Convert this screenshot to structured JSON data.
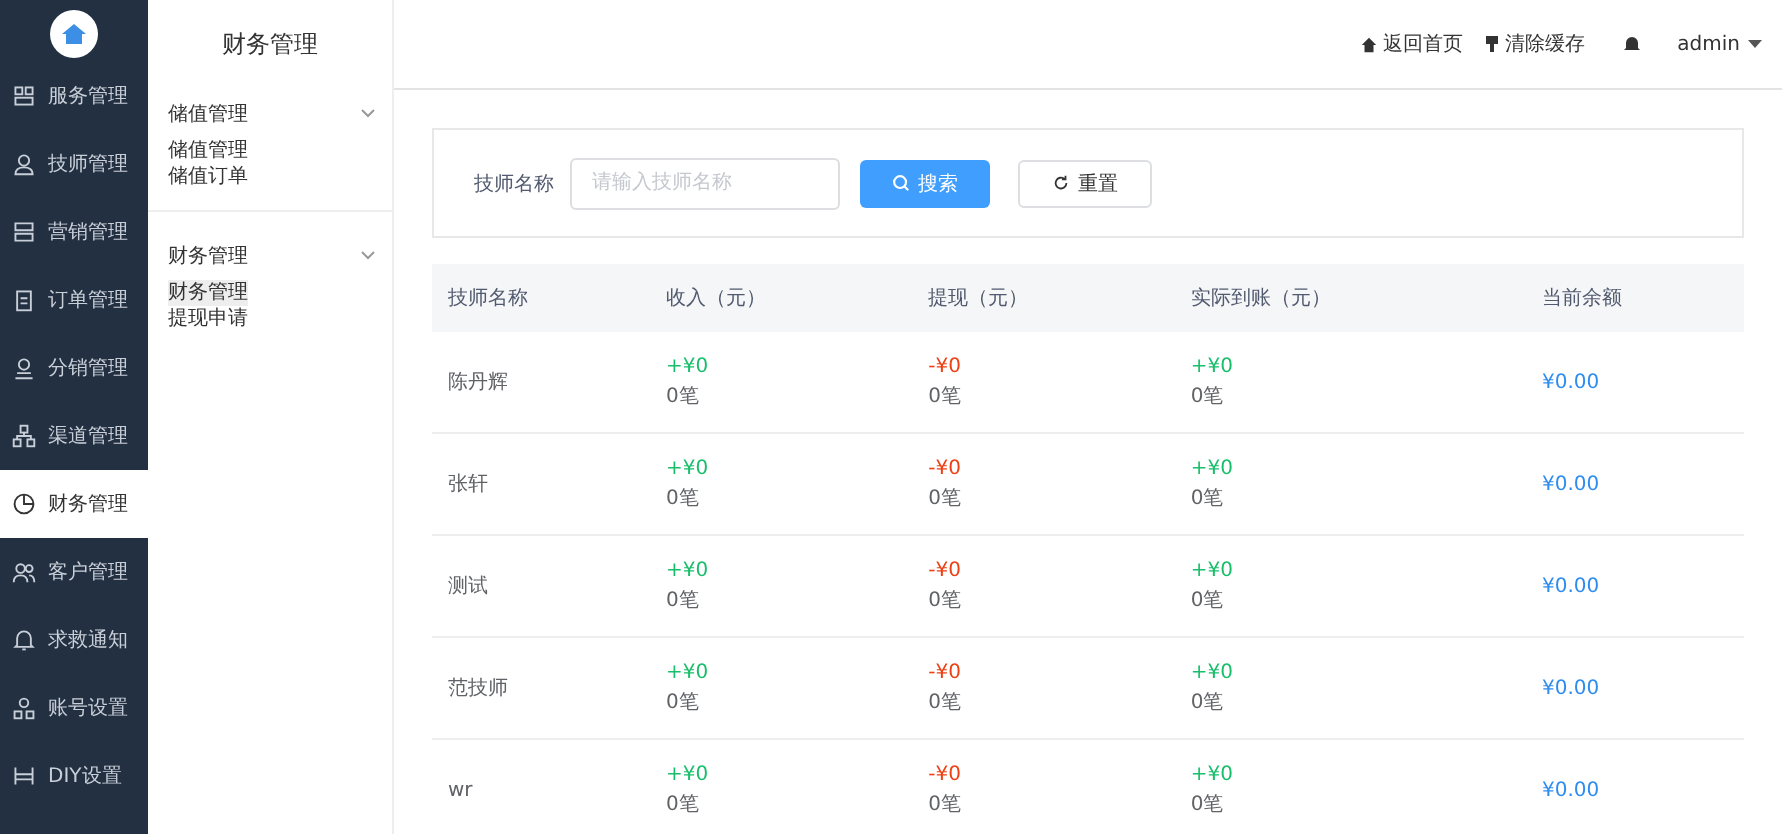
{
  "sidebar": {
    "items": [
      {
        "label": "服务管理",
        "selected": false
      },
      {
        "label": "技师管理",
        "selected": false
      },
      {
        "label": "营销管理",
        "selected": false
      },
      {
        "label": "订单管理",
        "selected": false
      },
      {
        "label": "分销管理",
        "selected": false
      },
      {
        "label": "渠道管理",
        "selected": false
      },
      {
        "label": "财务管理",
        "selected": true
      },
      {
        "label": "客户管理",
        "selected": false
      },
      {
        "label": "求救通知",
        "selected": false
      },
      {
        "label": "账号设置",
        "selected": false
      },
      {
        "label": "DIY设置",
        "selected": false
      }
    ]
  },
  "submenu": {
    "title": "财务管理",
    "groups": [
      {
        "title": "储值管理",
        "items": [
          {
            "label": "储值管理",
            "selected": false
          },
          {
            "label": "储值订单",
            "selected": false
          }
        ]
      },
      {
        "title": "财务管理",
        "items": [
          {
            "label": "财务管理",
            "selected": true
          },
          {
            "label": "提现申请",
            "selected": false
          }
        ]
      }
    ]
  },
  "top_bar": {
    "links": [
      {
        "label": "返回首页",
        "kind": "home"
      },
      {
        "label": "清除缓存",
        "kind": "clear"
      }
    ],
    "user": "admin"
  },
  "search": {
    "label": "技师名称",
    "placeholder": "请输入技师名称",
    "search_button": "搜索",
    "reset_button": "重置"
  },
  "table": {
    "columns": [
      "技师名称",
      "收入（元）",
      "提现（元）",
      "实际到账（元）",
      "当前余额"
    ],
    "rows": [
      {
        "name": "陈丹辉",
        "income": {
          "amount": "+¥0",
          "count": "0笔"
        },
        "withdraw": {
          "amount": "-¥0",
          "count": "0笔"
        },
        "actual": {
          "amount": "+¥0",
          "count": "0笔"
        },
        "balance": "¥0.00"
      },
      {
        "name": "张轩",
        "income": {
          "amount": "+¥0",
          "count": "0笔"
        },
        "withdraw": {
          "amount": "-¥0",
          "count": "0笔"
        },
        "actual": {
          "amount": "+¥0",
          "count": "0笔"
        },
        "balance": "¥0.00"
      },
      {
        "name": "测试",
        "income": {
          "amount": "+¥0",
          "count": "0笔"
        },
        "withdraw": {
          "amount": "-¥0",
          "count": "0笔"
        },
        "actual": {
          "amount": "+¥0",
          "count": "0笔"
        },
        "balance": "¥0.00"
      },
      {
        "name": "范技师",
        "income": {
          "amount": "+¥0",
          "count": "0笔"
        },
        "withdraw": {
          "amount": "-¥0",
          "count": "0笔"
        },
        "actual": {
          "amount": "+¥0",
          "count": "0笔"
        },
        "balance": "¥0.00"
      },
      {
        "name": "wr",
        "income": {
          "amount": "+¥0",
          "count": "0笔"
        },
        "withdraw": {
          "amount": "-¥0",
          "count": "0笔"
        },
        "actual": {
          "amount": "+¥0",
          "count": "0笔"
        },
        "balance": "¥0.00"
      }
    ]
  }
}
